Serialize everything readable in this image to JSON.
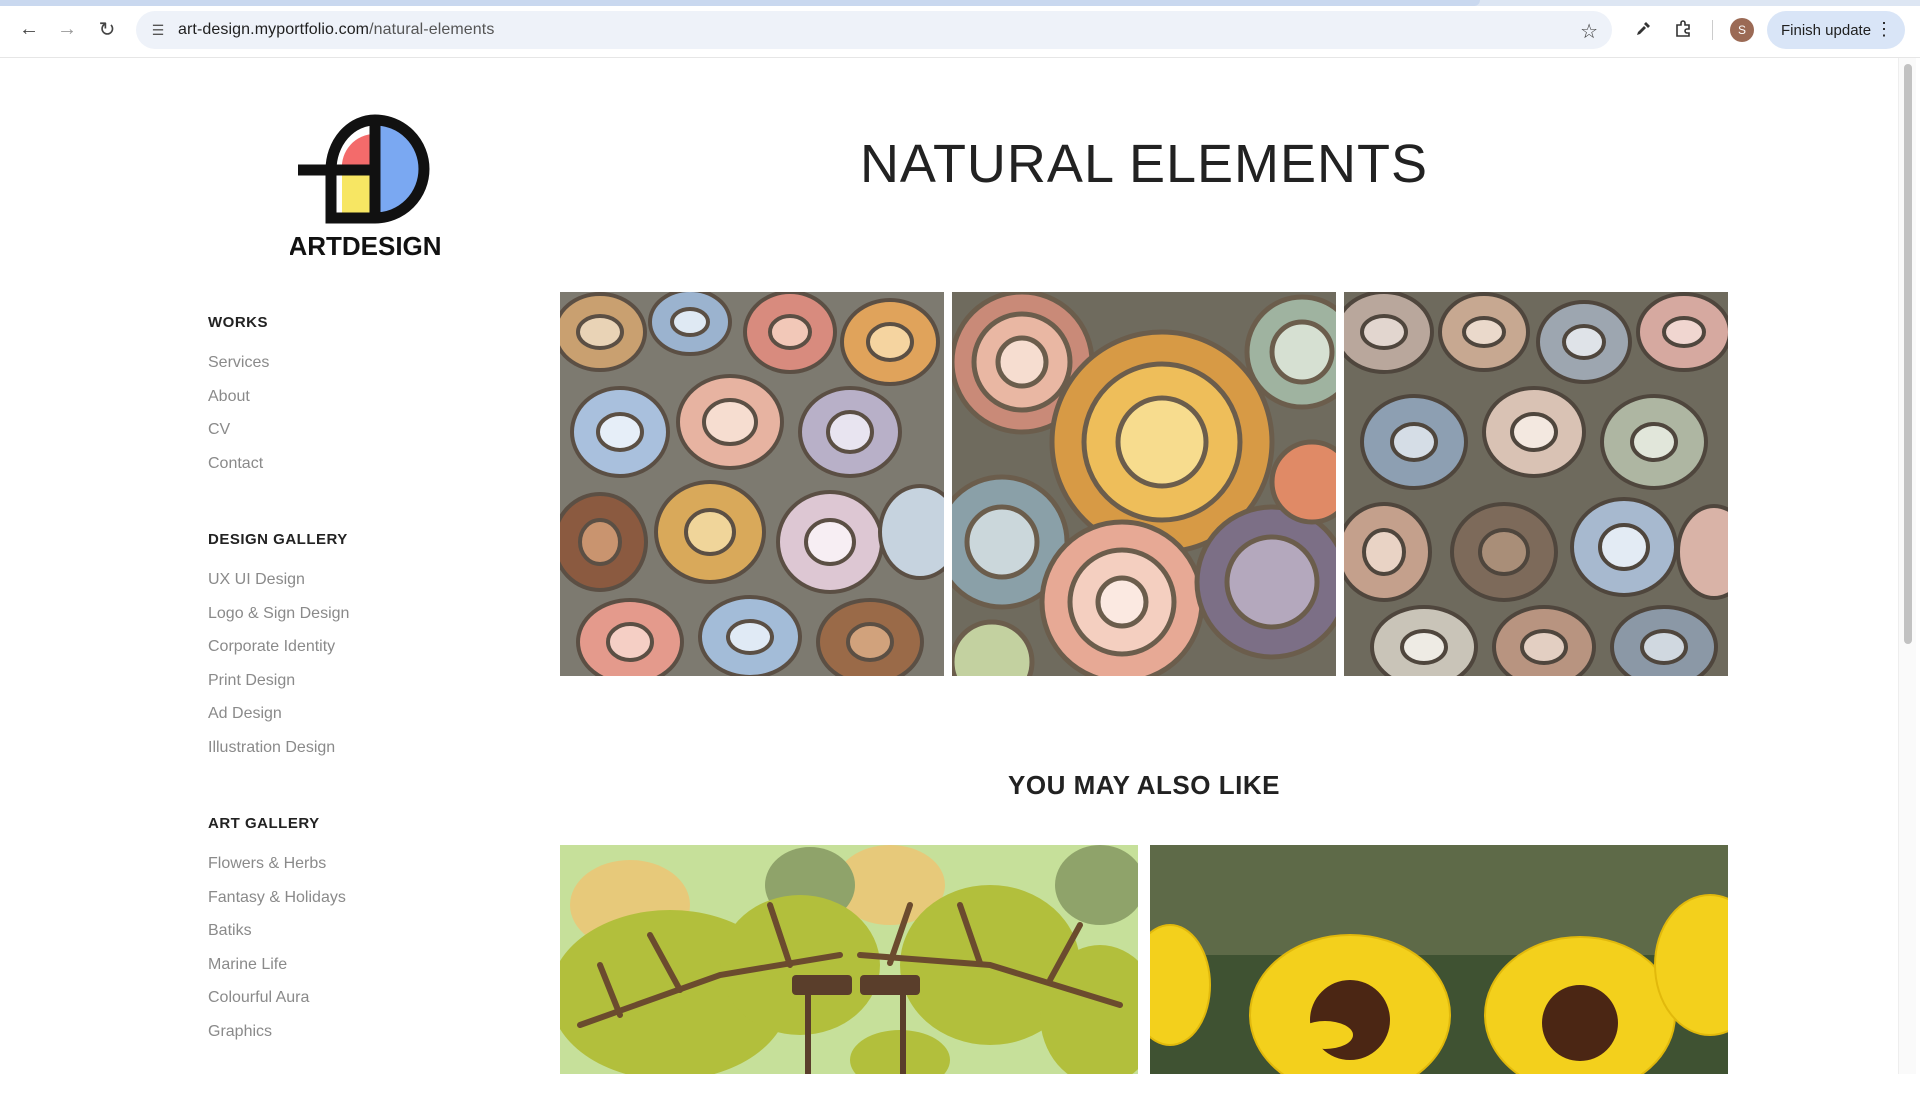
{
  "browser": {
    "url_host": "art-design.myportfolio.com",
    "url_path": "/natural-elements",
    "avatar_initial": "S",
    "finish_update_label": "Finish update"
  },
  "logo": {
    "wordmark": "ARTDESIGN",
    "monogram": "AD",
    "colors": {
      "red": "#f36b6b",
      "blue": "#7aa8f2",
      "yellow": "#f7e663",
      "black": "#111111"
    }
  },
  "sidebar": {
    "works": {
      "title": "WORKS",
      "items": [
        "Services",
        "About",
        "CV",
        "Contact"
      ]
    },
    "design_gallery": {
      "title": "DESIGN GALLERY",
      "items": [
        "UX UI Design",
        "Logo & Sign Design",
        "Corporate Identity",
        "Print Design",
        "Ad Design",
        "Illustration Design"
      ]
    },
    "art_gallery": {
      "title": "ART GALLERY",
      "items": [
        "Flowers & Herbs",
        "Fantasy & Holidays",
        "Batiks",
        "Marine Life",
        "Colourful Aura",
        "Graphics"
      ]
    }
  },
  "main": {
    "title": "NATURAL ELEMENTS",
    "also_like_title": "YOU MAY ALSO LIKE"
  }
}
